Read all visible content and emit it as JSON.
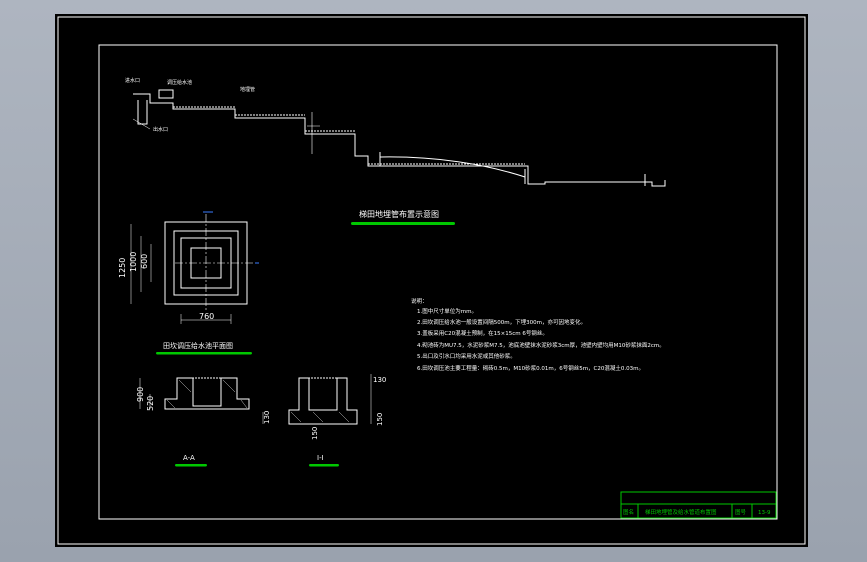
{
  "drawing": {
    "profile_title": "梯田地埋管布置示意图",
    "plan_title": "田坎调压给水池平面图",
    "section_a_label": "A-A",
    "section_i_label": "I-I",
    "plan_dims": {
      "overall": "1250",
      "mid": "1000",
      "inner": "600",
      "width": "760"
    },
    "section_dims": {
      "height_total": "900",
      "height_part": "520",
      "base": "130",
      "cap": "130",
      "depth": "150",
      "base2": "150"
    },
    "notes_title": "说明：",
    "notes": [
      "1.图中尺寸单位为mm。",
      "2.田坎调压给水池一般设置间隔500m，下埋300m，亦可因地变化。",
      "3.盖板采用C20混凝土预制，在15×15cm 6号钢丝。",
      "4.砌池砖为MU7.5，水泥砂浆M7.5，池底池壁抹水泥砂浆3cm厚，池壁内壁均用M10砂浆抹面2cm。",
      "5.出口及引水口均采用水泥或其他砂浆。",
      "6.田坎调压池主要工程量：砌砖0.5m，M10砂浆0.01m，6号钢丝5m，C20混凝土0.03m。"
    ],
    "profile_labels": [
      "进水口",
      "调压给水池",
      "地埋管",
      "出水口"
    ],
    "titleblock": {
      "name_label": "图名",
      "name": "梯田地埋管及给水管道布置图",
      "num_label": "图号",
      "num": "13-9"
    }
  },
  "colors": {
    "line": "#ffffff",
    "highlight": "#00c800",
    "background": "#000000",
    "page": "#a6adb8"
  }
}
